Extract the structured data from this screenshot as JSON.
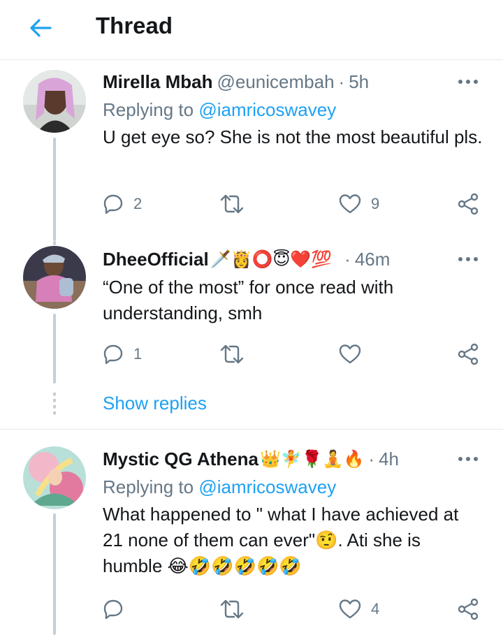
{
  "header": {
    "title": "Thread",
    "back_icon": "arrow-left-icon"
  },
  "colors": {
    "accent": "#1da1f2",
    "secondary_text": "#657786",
    "thread_line": "#c4cfd6",
    "like_icon": "#657786"
  },
  "tweets": [
    {
      "name": "Mirella Mbah",
      "handle": "@eunicembah",
      "sep": "·",
      "time": "5h",
      "replying_label": "Replying to",
      "replying_handle": "@iamricoswavey",
      "text": "U get eye so? She is not the most beautiful pls.",
      "replies": "2",
      "retweets": "",
      "likes": "9"
    },
    {
      "name": "DheeOfficial",
      "name_emojis": "🗡️👸⭕😇❤️💯",
      "sep": "·",
      "time": "46m",
      "text": "“One of the most” for once read with understanding, smh",
      "replies": "1",
      "retweets": "",
      "likes": ""
    },
    {
      "name": "Mystic QG Athena",
      "name_emojis": "👑🧚🌹🧘🔥",
      "sep": "·",
      "time": "4h",
      "replying_label": "Replying to",
      "replying_handle": "@iamricoswavey",
      "text": "What happened to \" what I have achieved at 21 none of them can ever\"🤨. Ati she is humble 😂🤣🤣🤣🤣🤣",
      "replies": "",
      "retweets": "",
      "likes": "4"
    }
  ],
  "show_replies": "Show replies"
}
